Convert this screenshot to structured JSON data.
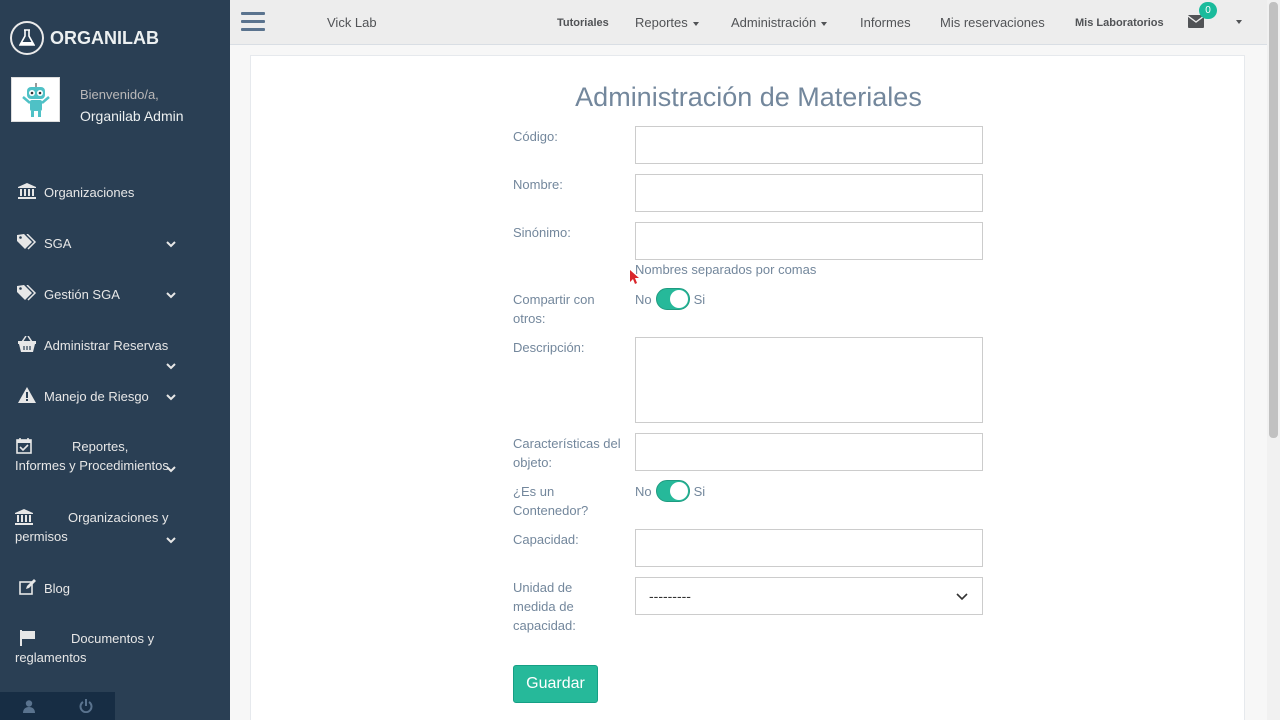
{
  "brand": {
    "name": "ORGANILAB"
  },
  "profile": {
    "welcome": "Bienvenido/a,",
    "name": "Organilab Admin"
  },
  "sidebar": {
    "items": [
      {
        "label": "Organizaciones",
        "icon": "bank-icon",
        "has_submenu": false
      },
      {
        "label": "SGA",
        "icon": "tags-icon",
        "has_submenu": true
      },
      {
        "label": "Gestión SGA",
        "icon": "tags-icon",
        "has_submenu": true
      },
      {
        "label": "Administrar Reservas",
        "icon": "basket-icon",
        "has_submenu": true
      },
      {
        "label": "Manejo de Riesgo",
        "icon": "warning-icon",
        "has_submenu": true
      },
      {
        "label": "Reportes, Informes y Procedimientos",
        "icon": "calendar-check-icon",
        "has_submenu": true
      },
      {
        "label": "Organizaciones y permisos",
        "icon": "bank-icon",
        "has_submenu": true
      },
      {
        "label": "Blog",
        "icon": "edit-icon",
        "has_submenu": false
      },
      {
        "label": "Documentos y reglamentos",
        "icon": "flag-icon",
        "has_submenu": false
      }
    ],
    "footer": {
      "user_icon": "user-icon",
      "power_icon": "power-icon"
    }
  },
  "topbar": {
    "lab_name": "Vick Lab",
    "nav": {
      "tutoriales": "Tutoriales",
      "reportes": "Reportes",
      "administracion": "Administración",
      "informes": "Informes",
      "mis_reservaciones": "Mis reservaciones",
      "mis_laboratorios": "Mis Laboratorios"
    },
    "notifications_count": "0"
  },
  "form": {
    "title": "Administración de Materiales",
    "labels": {
      "codigo": "Código:",
      "nombre": "Nombre:",
      "sinonimo": "Sinónimo:",
      "compartir": "Compartir con otros:",
      "descripcion": "Descripción:",
      "caracteristicas": "Características del objeto:",
      "contenedor": "¿Es un Contenedor?",
      "capacidad": "Capacidad:",
      "unidad": "Unidad de medida de capacidad:"
    },
    "values": {
      "codigo": "",
      "nombre": "",
      "sinonimo": "",
      "descripcion": "",
      "caracteristicas": "",
      "capacidad": ""
    },
    "sinonimo_help": "Nombres separados por comas",
    "switch_no": "No",
    "switch_si": "Si",
    "compartir_on": true,
    "contenedor_on": true,
    "unidad_selected": "---------",
    "save_label": "Guardar"
  },
  "colors": {
    "sidebar": "#2a3f54",
    "accent": "#26b99a",
    "text": "#73879c"
  }
}
